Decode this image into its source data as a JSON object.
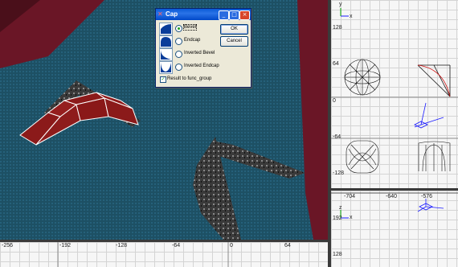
{
  "dialog": {
    "title": "Cap",
    "minimize": "_",
    "maximize": "□",
    "close": "×",
    "options": [
      {
        "label": "Bevel",
        "selected": true
      },
      {
        "label": "Endcap",
        "selected": false
      },
      {
        "label": "Inverted Bevel",
        "selected": false
      },
      {
        "label": "Inverted Endcap",
        "selected": false
      }
    ],
    "ok_label": "OK",
    "cancel_label": "Cancel",
    "checkbox_label": "Result to func_group",
    "checkbox_checked": true
  },
  "viewports": {
    "top_right": {
      "axis_x": "x",
      "axis_y": "y",
      "y_labels": [
        "128",
        "64",
        "0",
        "-64",
        "-128"
      ]
    },
    "bottom_right": {
      "x_labels": [
        "-704",
        "-640",
        "-576"
      ],
      "y_labels": [
        "192",
        "128"
      ],
      "axis_x": "x",
      "axis_y": "z"
    },
    "bottom_left": {
      "x_labels": [
        "-256",
        "-192",
        "-128",
        "-64",
        "0",
        "64"
      ]
    }
  },
  "colors": {
    "water": "#1d5064",
    "wall": "#6a1626",
    "selection": "#8b1a1a",
    "axis_blue": "#1a1aff",
    "axis_green": "#00a000",
    "curve_red": "#d01010"
  }
}
